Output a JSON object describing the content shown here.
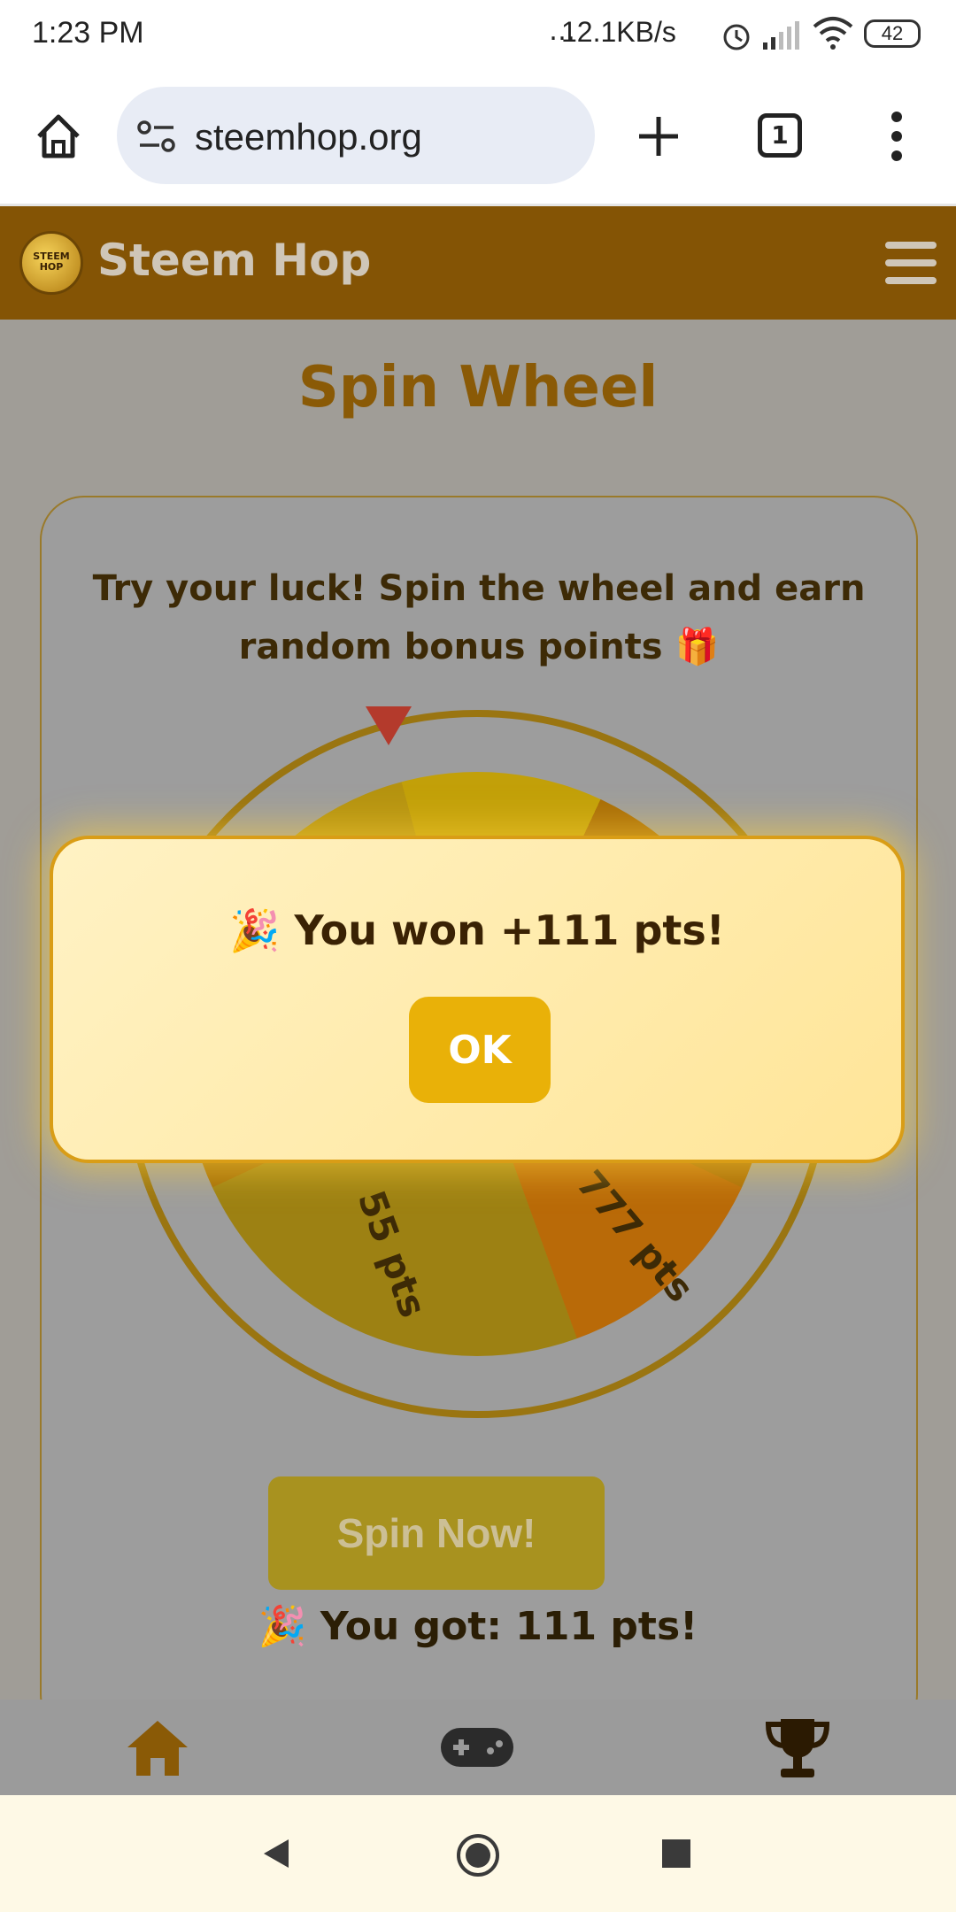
{
  "status_bar": {
    "time": "1:23 PM",
    "net_speed": "12.1KB/s",
    "battery": "42"
  },
  "browser": {
    "url": "steemhop.org",
    "tab_count": "1"
  },
  "header": {
    "brand": "Steem Hop",
    "logo_text": "STEEM HOP"
  },
  "page": {
    "title": "Spin Wheel",
    "intro_line1": "Try your luck! Spin the wheel and earn",
    "intro_line2": "random bonus points 🎁",
    "wheel_labels": [
      "55 pts",
      "777 pts"
    ],
    "spin_button": "Spin Now!",
    "result": "🎉 You got: 111 pts!"
  },
  "modal": {
    "message": "🎉 You won +111 pts!",
    "ok_label": "OK"
  },
  "bottom_nav": [
    "home-icon",
    "gamepad-icon",
    "trophy-icon"
  ],
  "colors": {
    "header": "#845405",
    "accent": "#e9b108",
    "modal_border": "#d99d16"
  }
}
